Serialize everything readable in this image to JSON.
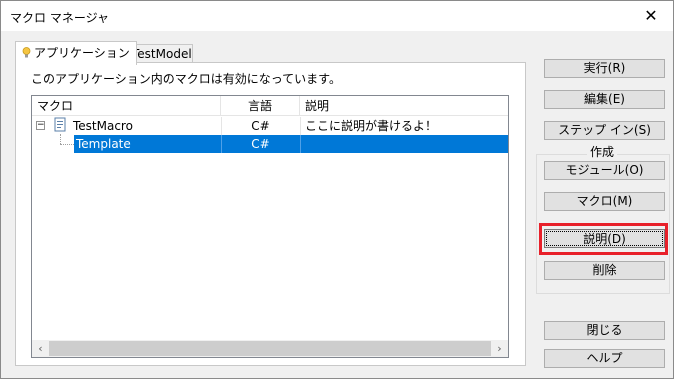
{
  "window": {
    "title": "マクロ マネージャ"
  },
  "tabs": [
    {
      "label": "アプリケーション",
      "icon": "lightbulb-icon",
      "active": true
    },
    {
      "label": "TestModel",
      "icon": "lightbulb-icon",
      "active": false
    }
  ],
  "panel": {
    "info_text": "このアプリケーション内のマクロは有効になっています。",
    "columns": [
      "マクロ",
      "言語",
      "説明"
    ],
    "rows": [
      {
        "name": "TestMacro",
        "lang": "C#",
        "desc": "ここに説明が書けるよ！"
      },
      {
        "name": "Template",
        "lang": "C#",
        "desc": ""
      }
    ]
  },
  "buttons": {
    "run": "実行(R)",
    "edit": "編集(E)",
    "step_in": "ステップ イン(S)",
    "create_group": "作成",
    "module": "モジュール(O)",
    "macro": "マクロ(M)",
    "description": "説明(D)",
    "delete": "削除",
    "close": "閉じる",
    "help": "ヘルプ"
  },
  "colors": {
    "selection": "#0078d7",
    "highlight_border": "#e8202a",
    "tab_icon": "#f5c542"
  }
}
